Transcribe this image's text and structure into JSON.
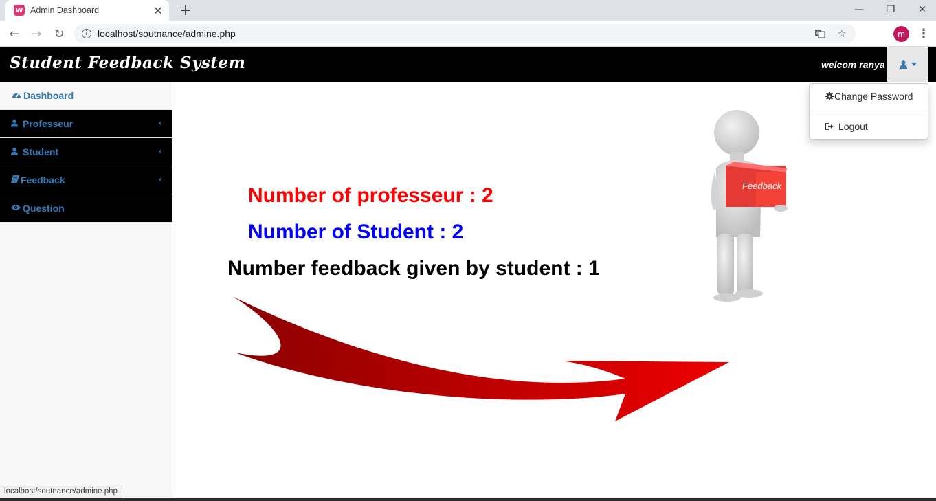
{
  "browser": {
    "tab_title": "Admin Dashboard",
    "favicon_letter": "W",
    "url": "localhost/soutnance/admine.php",
    "profile_initial": "m",
    "status_url": "localhost/soutnance/admine.php"
  },
  "navbar": {
    "brand": "Student Feedback System",
    "welcome": "welcom ranya"
  },
  "user_menu": {
    "items": [
      {
        "label": "Change Password",
        "icon": "gear-icon"
      },
      {
        "label": "Logout",
        "icon": "sign-out-icon"
      }
    ]
  },
  "sidebar": {
    "items": [
      {
        "label": "Dashboard",
        "icon": "dashboard-icon",
        "active": true
      },
      {
        "label": "Professeur",
        "icon": "user-icon",
        "has_submenu": true
      },
      {
        "label": "Student",
        "icon": "user-icon",
        "has_submenu": true
      },
      {
        "label": "Feedback",
        "icon": "book-icon",
        "has_submenu": true
      },
      {
        "label": "Question",
        "icon": "eye-icon"
      }
    ]
  },
  "stats": {
    "professeur": "Number of professeur : 2",
    "student": "Number of Student : 2",
    "feedback": "Number feedback given by student : 1"
  },
  "illustration": {
    "box_label": "Feedback"
  },
  "colors": {
    "professeur_text": "#ff0000",
    "student_text": "#0000ff",
    "feedback_text": "#000000",
    "link": "#337ab7",
    "arrow": "#cc0000"
  }
}
